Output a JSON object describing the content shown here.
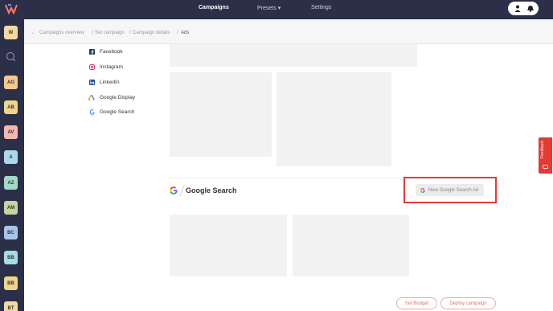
{
  "topbar": {
    "nav": [
      {
        "label": "Campaigns",
        "active": true
      },
      {
        "label": "Presets",
        "icon": "caret-down-icon"
      },
      {
        "label": "Settings"
      }
    ],
    "user_icon": "user-icon",
    "bell_icon": "bell-icon"
  },
  "sidebar": {
    "search_icon": "search-icon",
    "workspaces": [
      {
        "label": "W",
        "color": "#f3d9a4"
      },
      {
        "label": "AG",
        "color": "#f3c98e"
      },
      {
        "label": "AB",
        "color": "#f0d48a"
      },
      {
        "label": "AV",
        "color": "#f5b7b1"
      },
      {
        "label": "A",
        "color": "#a8d8ea"
      },
      {
        "label": "AZ",
        "color": "#a3d9c9"
      },
      {
        "label": "AM",
        "color": "#c5d4a0"
      },
      {
        "label": "BC",
        "color": "#a9c4e8"
      },
      {
        "label": "BB",
        "color": "#a8dce0"
      },
      {
        "label": "BB",
        "color": "#f0d48a"
      },
      {
        "label": "BT",
        "color": "#f3d9a4"
      }
    ]
  },
  "breadcrumb": {
    "back_icon": "arrow-left-icon",
    "items": [
      "Campaigns overview",
      "Set campaign",
      "Campaign details",
      "Ads"
    ],
    "separator": "/"
  },
  "channels": [
    {
      "label": "Facebook",
      "icon": "facebook-icon"
    },
    {
      "label": "Instagram",
      "icon": "instagram-icon"
    },
    {
      "label": "LinkedIn",
      "icon": "linkedin-icon"
    },
    {
      "label": "Google Display",
      "icon": "google-ads-icon"
    },
    {
      "label": "Google Search",
      "icon": "google-icon"
    }
  ],
  "google_search_section": {
    "title": "Google Search",
    "new_ad_button": "New Google Search Ad"
  },
  "footer": {
    "set_budget": "Set Budget",
    "deploy": "Deploy campaign"
  },
  "feedback_tab": "Feedback",
  "colors": {
    "nav_bg": "#2c2f48",
    "accent_red": "#e53935",
    "placeholder": "#f2f2f2"
  }
}
